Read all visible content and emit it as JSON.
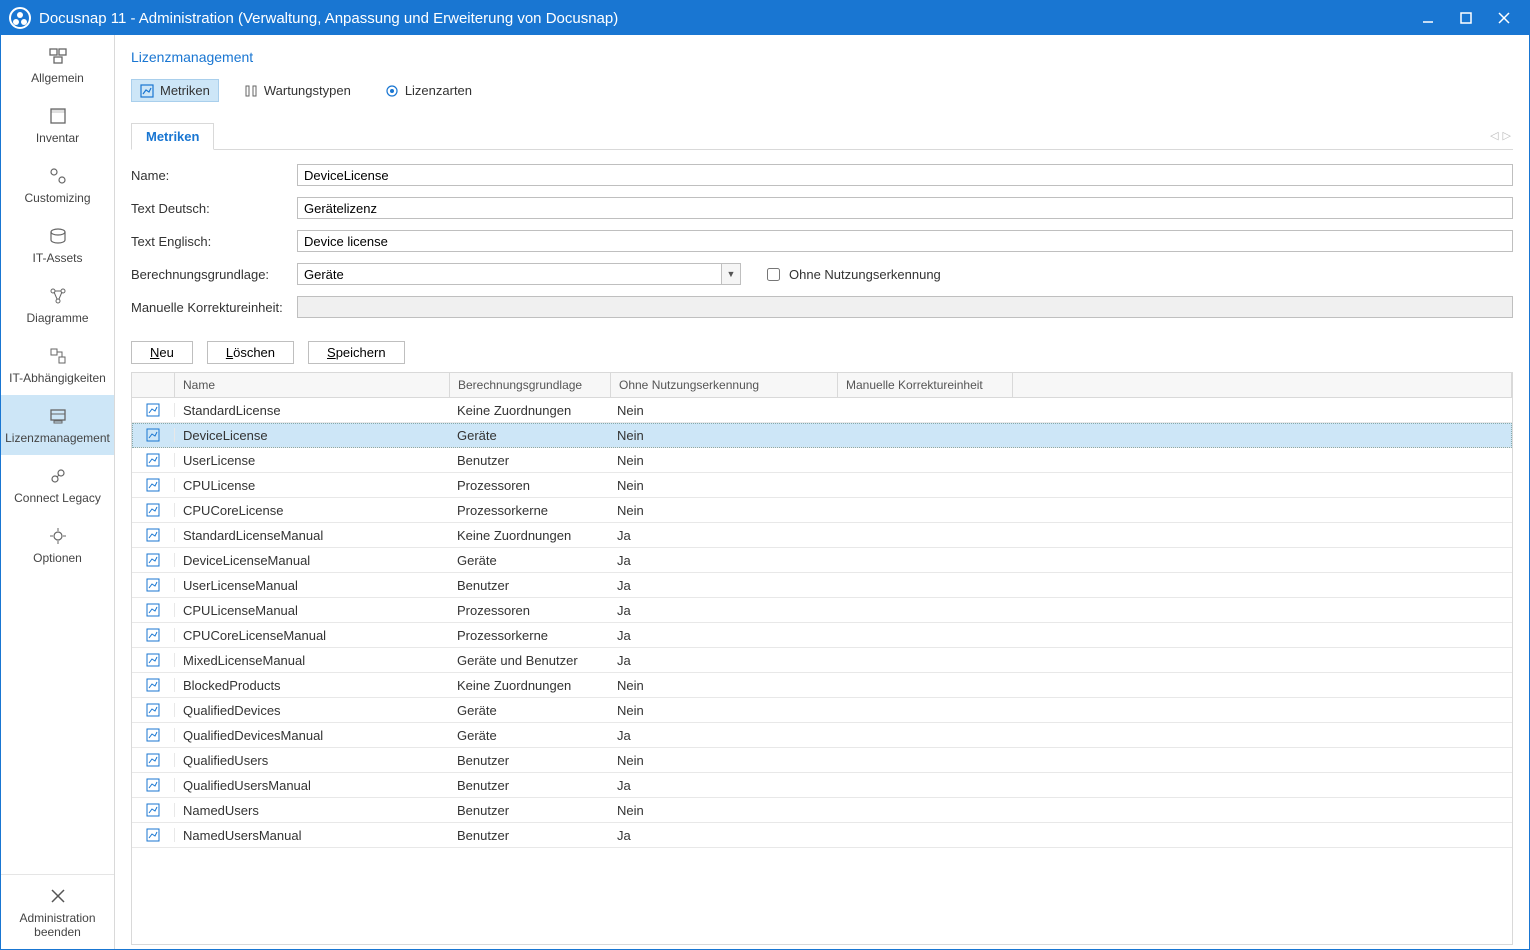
{
  "window": {
    "title": "Docusnap 11 - Administration (Verwaltung, Anpassung und Erweiterung von Docusnap)"
  },
  "sidebar": {
    "items": [
      {
        "label": "Allgemein"
      },
      {
        "label": "Inventar"
      },
      {
        "label": "Customizing"
      },
      {
        "label": "IT-Assets"
      },
      {
        "label": "Diagramme"
      },
      {
        "label": "IT-Abhängigkeiten"
      },
      {
        "label": "Lizenzmanagement"
      },
      {
        "label": "Connect Legacy"
      },
      {
        "label": "Optionen"
      }
    ],
    "exit": {
      "line1": "Administration",
      "line2": "beenden"
    }
  },
  "breadcrumb": "Lizenzmanagement",
  "sectabs": {
    "metriken": "Metriken",
    "wartung": "Wartungstypen",
    "lizenzarten": "Lizenzarten"
  },
  "innertab": "Metriken",
  "form": {
    "name_label": "Name:",
    "name_value": "DeviceLicense",
    "textde_label": "Text Deutsch:",
    "textde_value": "Gerätelizenz",
    "texten_label": "Text Englisch:",
    "texten_value": "Device license",
    "calc_label": "Berechnungsgrundlage:",
    "calc_value": "Geräte",
    "ohne_label": "Ohne Nutzungserkennung",
    "manuelle_label": "Manuelle Korrektureinheit:"
  },
  "buttons": {
    "neu_pre": "",
    "neu_u": "N",
    "neu_post": "eu",
    "loe_pre": "",
    "loe_u": "L",
    "loe_post": "öschen",
    "sp_pre": "",
    "sp_u": "S",
    "sp_post": "peichern"
  },
  "grid": {
    "headers": {
      "name": "Name",
      "calc": "Berechnungsgrundlage",
      "ohne": "Ohne Nutzungserkennung",
      "man": "Manuelle Korrektureinheit"
    },
    "rows": [
      {
        "name": "StandardLicense",
        "calc": "Keine Zuordnungen",
        "ohne": "Nein",
        "man": ""
      },
      {
        "name": "DeviceLicense",
        "calc": "Geräte",
        "ohne": "Nein",
        "man": "",
        "selected": true
      },
      {
        "name": "UserLicense",
        "calc": "Benutzer",
        "ohne": "Nein",
        "man": ""
      },
      {
        "name": "CPULicense",
        "calc": "Prozessoren",
        "ohne": "Nein",
        "man": ""
      },
      {
        "name": "CPUCoreLicense",
        "calc": "Prozessorkerne",
        "ohne": "Nein",
        "man": ""
      },
      {
        "name": "StandardLicenseManual",
        "calc": "Keine Zuordnungen",
        "ohne": "Ja",
        "man": ""
      },
      {
        "name": "DeviceLicenseManual",
        "calc": "Geräte",
        "ohne": "Ja",
        "man": ""
      },
      {
        "name": "UserLicenseManual",
        "calc": "Benutzer",
        "ohne": "Ja",
        "man": ""
      },
      {
        "name": "CPULicenseManual",
        "calc": "Prozessoren",
        "ohne": "Ja",
        "man": ""
      },
      {
        "name": "CPUCoreLicenseManual",
        "calc": "Prozessorkerne",
        "ohne": "Ja",
        "man": ""
      },
      {
        "name": "MixedLicenseManual",
        "calc": "Geräte und Benutzer",
        "ohne": "Ja",
        "man": ""
      },
      {
        "name": "BlockedProducts",
        "calc": "Keine Zuordnungen",
        "ohne": "Nein",
        "man": ""
      },
      {
        "name": "QualifiedDevices",
        "calc": "Geräte",
        "ohne": "Nein",
        "man": ""
      },
      {
        "name": "QualifiedDevicesManual",
        "calc": "Geräte",
        "ohne": "Ja",
        "man": ""
      },
      {
        "name": "QualifiedUsers",
        "calc": "Benutzer",
        "ohne": "Nein",
        "man": ""
      },
      {
        "name": "QualifiedUsersManual",
        "calc": "Benutzer",
        "ohne": "Ja",
        "man": ""
      },
      {
        "name": "NamedUsers",
        "calc": "Benutzer",
        "ohne": "Nein",
        "man": ""
      },
      {
        "name": "NamedUsersManual",
        "calc": "Benutzer",
        "ohne": "Ja",
        "man": ""
      }
    ]
  }
}
